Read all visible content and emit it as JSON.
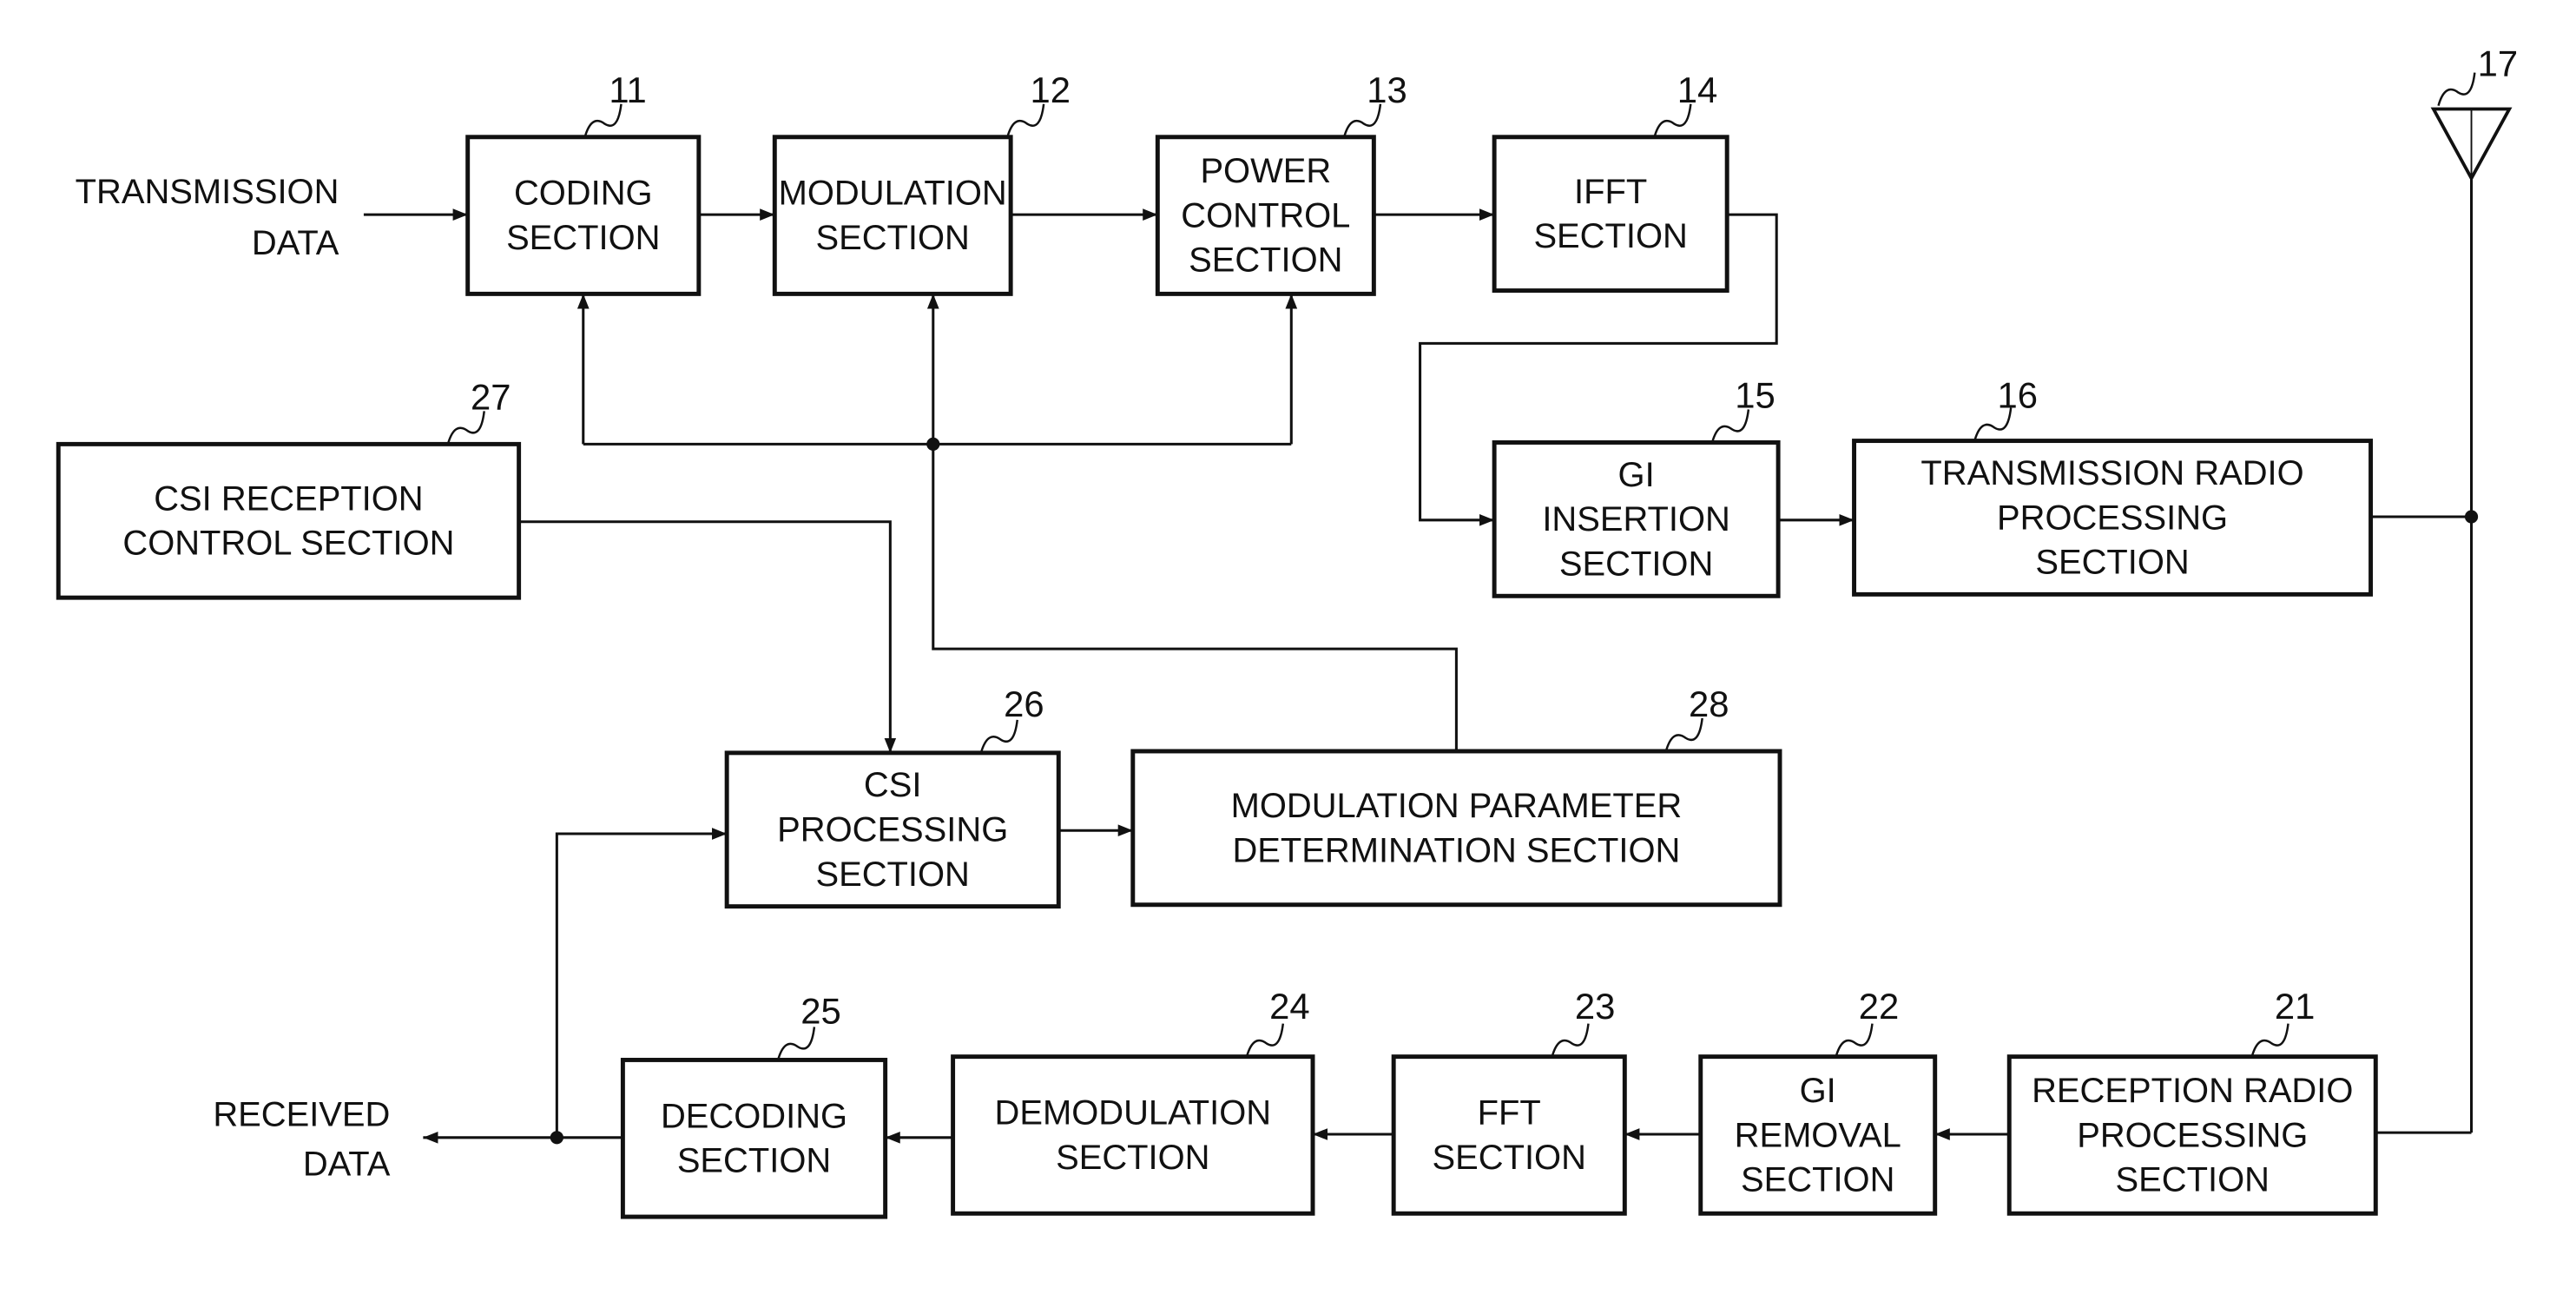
{
  "diagram": {
    "external": {
      "transmission_data": [
        "TRANSMISSION",
        "DATA"
      ],
      "received_data": [
        "RECEIVED",
        "DATA"
      ]
    },
    "blocks": [
      {
        "id": "coding",
        "ref": "11",
        "lines": [
          "CODING",
          "SECTION"
        ]
      },
      {
        "id": "modulation",
        "ref": "12",
        "lines": [
          "MODULATION",
          "SECTION"
        ]
      },
      {
        "id": "power-control",
        "ref": "13",
        "lines": [
          "POWER",
          "CONTROL",
          "SECTION"
        ]
      },
      {
        "id": "ifft",
        "ref": "14",
        "lines": [
          "IFFT",
          "SECTION"
        ]
      },
      {
        "id": "gi-insertion",
        "ref": "15",
        "lines": [
          "GI",
          "INSERTION",
          "SECTION"
        ]
      },
      {
        "id": "transmission-radio",
        "ref": "16",
        "lines": [
          "TRANSMISSION RADIO",
          "PROCESSING",
          "SECTION"
        ]
      },
      {
        "id": "reception-radio",
        "ref": "21",
        "lines": [
          "RECEPTION RADIO",
          "PROCESSING",
          "SECTION"
        ]
      },
      {
        "id": "gi-removal",
        "ref": "22",
        "lines": [
          "GI",
          "REMOVAL",
          "SECTION"
        ]
      },
      {
        "id": "fft",
        "ref": "23",
        "lines": [
          "FFT",
          "SECTION"
        ]
      },
      {
        "id": "demodulation",
        "ref": "24",
        "lines": [
          "DEMODULATION",
          "SECTION"
        ]
      },
      {
        "id": "decoding",
        "ref": "25",
        "lines": [
          "DECODING",
          "SECTION"
        ]
      },
      {
        "id": "csi-processing",
        "ref": "26",
        "lines": [
          "CSI",
          "PROCESSING",
          "SECTION"
        ]
      },
      {
        "id": "csi-reception-control",
        "ref": "27",
        "lines": [
          "CSI RECEPTION",
          "CONTROL SECTION"
        ]
      },
      {
        "id": "modulation-parameter",
        "ref": "28",
        "lines": [
          "MODULATION PARAMETER",
          "DETERMINATION SECTION"
        ]
      }
    ],
    "antenna": {
      "ref": "17"
    }
  }
}
